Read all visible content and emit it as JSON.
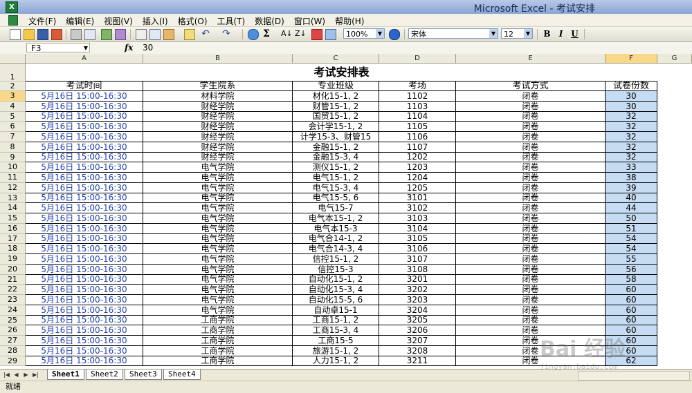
{
  "window": {
    "title": "Microsoft Excel - 考试安排",
    "app_icon": "X"
  },
  "menu": [
    "文件(F)",
    "编辑(E)",
    "视图(V)",
    "插入(I)",
    "格式(O)",
    "工具(T)",
    "数据(D)",
    "窗口(W)",
    "帮助(H)"
  ],
  "toolbar": {
    "zoom": "100%",
    "font": "宋体",
    "font_size": "12",
    "sum_label": "Σ",
    "bold_label": "B",
    "italic_label": "I",
    "underline_label": "U"
  },
  "formula_bar": {
    "cell_ref": "F3",
    "fx_label": "fx",
    "value": "30"
  },
  "columns": [
    "A",
    "B",
    "C",
    "D",
    "E",
    "F",
    "G"
  ],
  "sheet": {
    "title": "考试安排表",
    "headers": [
      "考试时间",
      "学生院系",
      "专业班级",
      "考场",
      "考试方式",
      "试卷份数"
    ],
    "row_numbers": [
      "1",
      "2",
      "3",
      "4",
      "5",
      "6",
      "7",
      "8",
      "9",
      "10",
      "11",
      "12",
      "13",
      "14",
      "15",
      "16",
      "17",
      "18",
      "19",
      "20",
      "21",
      "22",
      "23",
      "24",
      "25",
      "26",
      "27",
      "28",
      "29"
    ],
    "rows": [
      [
        "5月16日 15:00-16:30",
        "材料学院",
        "材化15-1, 2",
        "1102",
        "闭卷",
        "30"
      ],
      [
        "5月16日 15:00-16:30",
        "财经学院",
        "财管15-1, 2",
        "1103",
        "闭卷",
        "30"
      ],
      [
        "5月16日 15:00-16:30",
        "财经学院",
        "国贸15-1, 2",
        "1104",
        "闭卷",
        "32"
      ],
      [
        "5月16日 15:00-16:30",
        "财经学院",
        "会计学15-1, 2",
        "1105",
        "闭卷",
        "32"
      ],
      [
        "5月16日 15:00-16:30",
        "财经学院",
        "计学15-3、财管15",
        "1106",
        "闭卷",
        "32"
      ],
      [
        "5月16日 15:00-16:30",
        "财经学院",
        "金融15-1, 2",
        "1107",
        "闭卷",
        "32"
      ],
      [
        "5月16日 15:00-16:30",
        "财经学院",
        "金融15-3, 4",
        "1202",
        "闭卷",
        "32"
      ],
      [
        "5月16日 15:00-16:30",
        "电气学院",
        "测仪15-1, 2",
        "1203",
        "闭卷",
        "33"
      ],
      [
        "5月16日 15:00-16:30",
        "电气学院",
        "电气15-1, 2",
        "1204",
        "闭卷",
        "38"
      ],
      [
        "5月16日 15:00-16:30",
        "电气学院",
        "电气15-3, 4",
        "1205",
        "闭卷",
        "39"
      ],
      [
        "5月16日 15:00-16:30",
        "电气学院",
        "电气15-5, 6",
        "3101",
        "闭卷",
        "40"
      ],
      [
        "5月16日 15:00-16:30",
        "电气学院",
        "电气15-7",
        "3102",
        "闭卷",
        "44"
      ],
      [
        "5月16日 15:00-16:30",
        "电气学院",
        "电气本15-1, 2",
        "3103",
        "闭卷",
        "50"
      ],
      [
        "5月16日 15:00-16:30",
        "电气学院",
        "电气本15-3",
        "3104",
        "闭卷",
        "51"
      ],
      [
        "5月16日 15:00-16:30",
        "电气学院",
        "电气合14-1, 2",
        "3105",
        "闭卷",
        "54"
      ],
      [
        "5月16日 15:00-16:30",
        "电气学院",
        "电气合14-3, 4",
        "3106",
        "闭卷",
        "54"
      ],
      [
        "5月16日 15:00-16:30",
        "电气学院",
        "信控15-1, 2",
        "3107",
        "闭卷",
        "55"
      ],
      [
        "5月16日 15:00-16:30",
        "电气学院",
        "信控15-3",
        "3108",
        "闭卷",
        "56"
      ],
      [
        "5月16日 15:00-16:30",
        "电气学院",
        "自动化15-1, 2",
        "3201",
        "闭卷",
        "58"
      ],
      [
        "5月16日 15:00-16:30",
        "电气学院",
        "自动化15-3, 4",
        "3202",
        "闭卷",
        "60"
      ],
      [
        "5月16日 15:00-16:30",
        "电气学院",
        "自动化15-5, 6",
        "3203",
        "闭卷",
        "60"
      ],
      [
        "5月16日 15:00-16:30",
        "电气学院",
        "自动卓15-1",
        "3204",
        "闭卷",
        "60"
      ],
      [
        "5月16日 15:00-16:30",
        "工商学院",
        "工商15-1, 2",
        "3205",
        "闭卷",
        "60"
      ],
      [
        "5月16日 15:00-16:30",
        "工商学院",
        "工商15-3, 4",
        "3206",
        "闭卷",
        "60"
      ],
      [
        "5月16日 15:00-16:30",
        "工商学院",
        "工商15-5",
        "3207",
        "闭卷",
        "60"
      ],
      [
        "5月16日 15:00-16:30",
        "工商学院",
        "旅游15-1, 2",
        "3208",
        "闭卷",
        "60"
      ],
      [
        "5月16日 15:00-16:30",
        "工商学院",
        "人力15-1, 2",
        "3211",
        "闭卷",
        "62"
      ]
    ]
  },
  "sheet_tabs": [
    "Sheet1",
    "Sheet2",
    "Sheet3",
    "Sheet4"
  ],
  "status": "就绪",
  "watermark": {
    "logo": "Bai 经验",
    "url": "jingyan.baidu.com"
  }
}
